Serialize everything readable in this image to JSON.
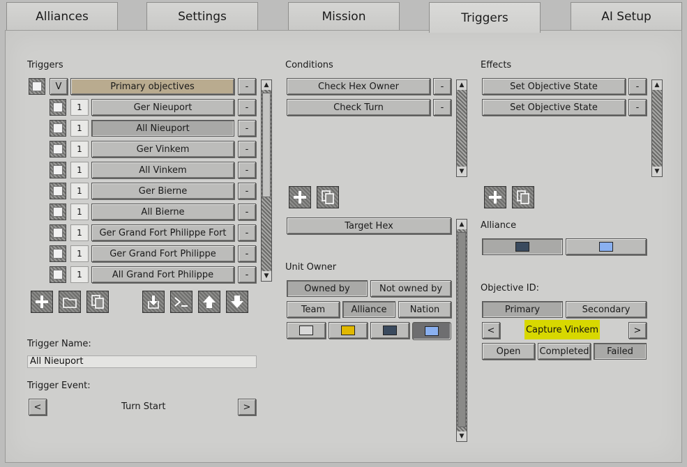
{
  "tabs": [
    "Alliances",
    "Settings",
    "Mission",
    "Triggers",
    "AI Setup"
  ],
  "triggers": {
    "heading": "Triggers",
    "group": {
      "toggle": "V",
      "label": "Primary objectives",
      "remove": "-"
    },
    "items": [
      {
        "num": "1",
        "label": "Ger Nieuport",
        "remove": "-"
      },
      {
        "num": "1",
        "label": "All Nieuport",
        "remove": "-"
      },
      {
        "num": "1",
        "label": "Ger Vinkem",
        "remove": "-"
      },
      {
        "num": "1",
        "label": "All Vinkem",
        "remove": "-"
      },
      {
        "num": "1",
        "label": "Ger Bierne",
        "remove": "-"
      },
      {
        "num": "1",
        "label": "All Bierne",
        "remove": "-"
      },
      {
        "num": "1",
        "label": "Ger Grand Fort Philippe Fort",
        "remove": "-"
      },
      {
        "num": "1",
        "label": "Ger Grand Fort Philippe",
        "remove": "-"
      },
      {
        "num": "1",
        "label": "All Grand Fort Philippe",
        "remove": "-"
      }
    ],
    "toolbar_icons": [
      "add-icon",
      "folder-icon",
      "copy-icon",
      "import-icon",
      "console-icon",
      "move-up-icon",
      "move-down-icon"
    ],
    "name_label": "Trigger Name:",
    "name_value": "All Nieuport",
    "event_label": "Trigger Event:",
    "event_value": "Turn Start",
    "prev": "<",
    "next": ">"
  },
  "conditions": {
    "heading": "Conditions",
    "items": [
      {
        "label": "Check Hex Owner",
        "remove": "-"
      },
      {
        "label": "Check Turn",
        "remove": "-"
      }
    ],
    "target_hex": "Target Hex",
    "unit_owner_label": "Unit Owner",
    "owned_by": "Owned by",
    "not_owned_by": "Not owned by",
    "team": "Team",
    "alliance": "Alliance",
    "nation": "Nation",
    "colors": [
      "#d8d8d8",
      "#e0b800",
      "#3a4a5e",
      "#8ab0f0"
    ]
  },
  "effects": {
    "heading": "Effects",
    "items": [
      {
        "label": "Set Objective State",
        "remove": "-"
      },
      {
        "label": "Set Objective State",
        "remove": "-"
      }
    ],
    "alliance_label": "Alliance",
    "alliance_colors": [
      "#3a4a5e",
      "#8ab0f0"
    ],
    "objective_label": "Objective ID:",
    "primary": "Primary",
    "secondary": "Secondary",
    "prev": "<",
    "next": ">",
    "objective_value": "Capture Vinkem",
    "open": "Open",
    "completed": "Completed",
    "failed": "Failed"
  }
}
